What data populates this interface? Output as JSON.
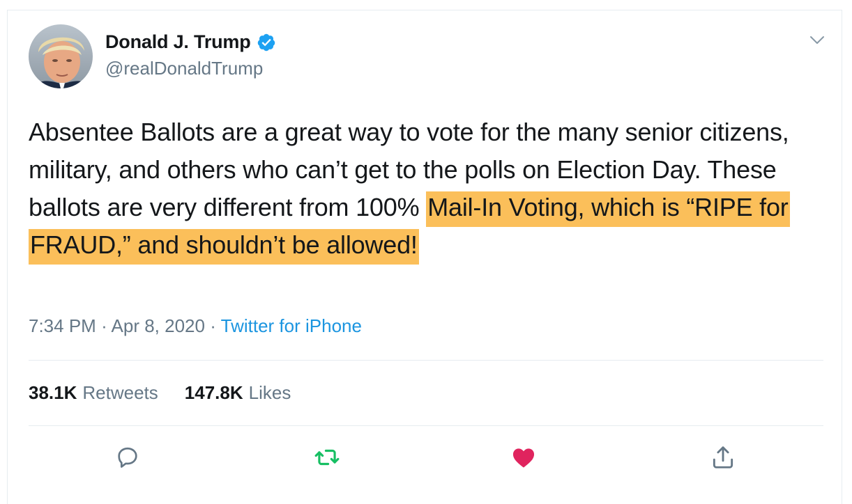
{
  "author": {
    "name": "Donald J. Trump",
    "handle": "@realDonaldTrump",
    "verified_icon": "verified-badge-icon",
    "avatar_icon": "profile-photo"
  },
  "tweet": {
    "text_plain": "Absentee Ballots are a great way to vote for the many senior citizens, military, and others who can’t get to the polls on Election Day. These ballots are very different from 100% ",
    "text_highlighted": "Mail-In Voting, which is “RIPE for FRAUD,” and shouldn’t be allowed!",
    "highlight_color": "#fbbf5a"
  },
  "meta": {
    "time": "7:34 PM",
    "separator": "·",
    "date": "Apr 8, 2020",
    "source": "Twitter for iPhone"
  },
  "stats": {
    "retweets_count": "38.1K",
    "retweets_label": "Retweets",
    "likes_count": "147.8K",
    "likes_label": "Likes"
  },
  "actions": {
    "reply_icon": "reply-icon",
    "retweet_icon": "retweet-icon",
    "like_icon": "heart-icon",
    "share_icon": "share-icon",
    "retweet_color": "#17bf63",
    "like_color": "#e0245e",
    "icon_color": "#657786"
  },
  "colors": {
    "link": "#1b95e0",
    "muted": "#657786",
    "border": "#e6ecf0"
  }
}
